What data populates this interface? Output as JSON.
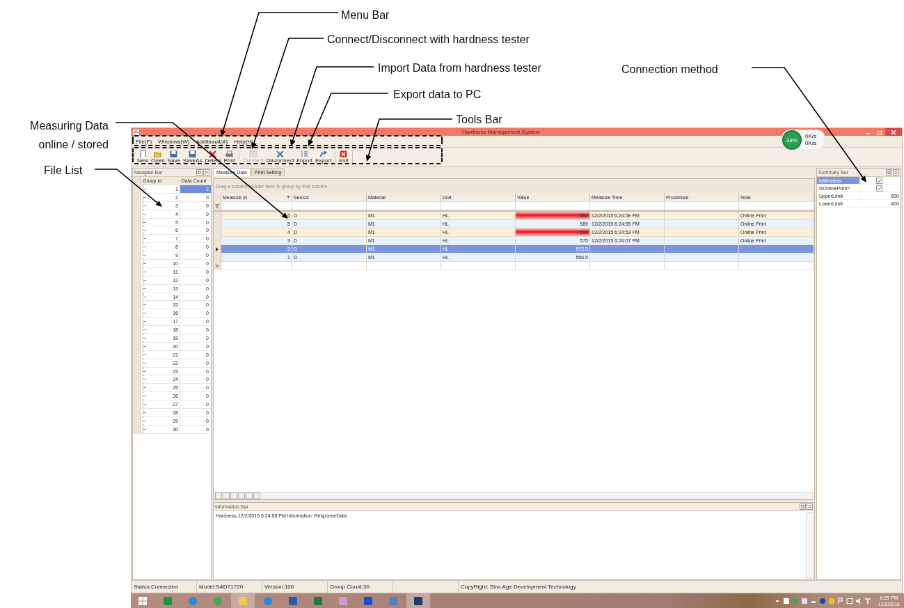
{
  "annotations": [
    {
      "lines": [
        "Menu Bar"
      ]
    },
    {
      "lines": [
        "Connect/Disconnect with hardness tester"
      ]
    },
    {
      "lines": [
        "Import Data from hardness tester"
      ]
    },
    {
      "lines": [
        "Export data to PC"
      ]
    },
    {
      "lines": [
        "Tools Bar"
      ]
    },
    {
      "lines": [
        "Connection method"
      ]
    },
    {
      "lines": [
        "Measuring Data",
        "online / stored"
      ]
    },
    {
      "lines": [
        "File List"
      ]
    }
  ],
  "window": {
    "title": "Hardness Management System"
  },
  "menu": [
    "File(F)",
    "Windows(W)",
    "Additional(A)",
    "Help(H)"
  ],
  "net_widget": {
    "percent": "38%",
    "up": "0K/s",
    "down": "0K/s"
  },
  "toolbar": [
    [
      {
        "label": "New",
        "kind": "new",
        "disabled": false
      },
      {
        "label": "Open",
        "kind": "open",
        "disabled": false
      },
      {
        "label": "Save",
        "kind": "save",
        "disabled": false
      },
      {
        "label": "SaveAs",
        "kind": "save",
        "disabled": false
      },
      {
        "label": "Delete",
        "kind": "delete",
        "disabled": false
      },
      {
        "label": "Print",
        "kind": "print",
        "disabled": false
      }
    ],
    [
      {
        "label": "Connect",
        "kind": "connect",
        "disabled": true
      },
      {
        "label": "Disconnect",
        "kind": "disconnect",
        "disabled": false
      },
      {
        "label": "Import",
        "kind": "import",
        "disabled": false
      },
      {
        "label": "Export",
        "kind": "export",
        "disabled": false
      }
    ],
    [
      {
        "label": "Exit",
        "kind": "exit",
        "disabled": false
      }
    ]
  ],
  "navigate_bar": {
    "title": "Navigate Bar",
    "columns": [
      "Group Id",
      "Data Count"
    ],
    "rows": [
      {
        "id": "1",
        "count": "2",
        "selected": true
      },
      {
        "id": "2",
        "count": "0",
        "selected": false
      },
      {
        "id": "3",
        "count": "0",
        "selected": false
      },
      {
        "id": "4",
        "count": "0",
        "selected": false
      },
      {
        "id": "5",
        "count": "0",
        "selected": false
      },
      {
        "id": "6",
        "count": "0",
        "selected": false
      },
      {
        "id": "7",
        "count": "0",
        "selected": false
      },
      {
        "id": "8",
        "count": "0",
        "selected": false
      },
      {
        "id": "9",
        "count": "0",
        "selected": false
      },
      {
        "id": "10",
        "count": "0",
        "selected": false
      },
      {
        "id": "11",
        "count": "0",
        "selected": false
      },
      {
        "id": "12",
        "count": "0",
        "selected": false
      },
      {
        "id": "13",
        "count": "0",
        "selected": false
      },
      {
        "id": "14",
        "count": "0",
        "selected": false
      },
      {
        "id": "15",
        "count": "0",
        "selected": false
      },
      {
        "id": "16",
        "count": "0",
        "selected": false
      },
      {
        "id": "17",
        "count": "0",
        "selected": false
      },
      {
        "id": "18",
        "count": "0",
        "selected": false
      },
      {
        "id": "19",
        "count": "0",
        "selected": false
      },
      {
        "id": "20",
        "count": "0",
        "selected": false
      },
      {
        "id": "21",
        "count": "0",
        "selected": false
      },
      {
        "id": "22",
        "count": "0",
        "selected": false
      },
      {
        "id": "23",
        "count": "0",
        "selected": false
      },
      {
        "id": "24",
        "count": "0",
        "selected": false
      },
      {
        "id": "25",
        "count": "0",
        "selected": false
      },
      {
        "id": "26",
        "count": "0",
        "selected": false
      },
      {
        "id": "27",
        "count": "0",
        "selected": false
      },
      {
        "id": "28",
        "count": "0",
        "selected": false
      },
      {
        "id": "29",
        "count": "0",
        "selected": false
      },
      {
        "id": "30",
        "count": "0",
        "selected": false
      }
    ]
  },
  "tabs": [
    {
      "label": "Measure Data",
      "selected": true
    },
    {
      "label": "Print Setting",
      "selected": false
    }
  ],
  "group_hint": "Drag a column header here to group by that column",
  "grid": {
    "columns": [
      "Measure Id",
      "Sensor",
      "Material",
      "Unit",
      "Value",
      "Measure Time",
      "Procedure",
      "Note"
    ],
    "rows": [
      {
        "cells": [
          "6",
          "D",
          "M1",
          "HL",
          "602",
          "12/2/2015 6:24:58 PM",
          "",
          "Online Print"
        ],
        "over_limit": true,
        "selected": false
      },
      {
        "cells": [
          "5",
          "D",
          "M1",
          "HL",
          "589",
          "12/2/2015 6:24:55 PM",
          "",
          "Online Print"
        ],
        "over_limit": false,
        "selected": false
      },
      {
        "cells": [
          "4",
          "D",
          "M1",
          "HL",
          "604",
          "12/2/2015 6:24:53 PM",
          "",
          "Online Print"
        ],
        "over_limit": true,
        "selected": false
      },
      {
        "cells": [
          "3",
          "D",
          "M1",
          "HL",
          "575",
          "12/2/2015 6:24:07 PM",
          "",
          "Online Print"
        ],
        "over_limit": false,
        "selected": false
      },
      {
        "cells": [
          "2",
          "D",
          "M1",
          "HL",
          "572.3",
          "",
          "",
          ""
        ],
        "over_limit": false,
        "selected": true
      },
      {
        "cells": [
          "1",
          "D",
          "M1",
          "HL",
          "566.5",
          "",
          "",
          ""
        ],
        "over_limit": false,
        "selected": false
      }
    ]
  },
  "info_bar": {
    "title": "Information Bar",
    "lines": [
      "Hardness,12/2/2015 6:24:58 PM Information: ResponseData:"
    ]
  },
  "summary_bar": {
    "title": "Summary Bar",
    "rows": [
      {
        "name": "IsWireless",
        "kind": "check",
        "checked": true,
        "selected": true
      },
      {
        "name": "IsOnlinePrint?",
        "kind": "check",
        "checked": true,
        "selected": false
      },
      {
        "name": "UpperLimit",
        "kind": "value",
        "value": "600",
        "selected": false
      },
      {
        "name": "LowerLimit",
        "kind": "value",
        "value": "400",
        "selected": false
      }
    ]
  },
  "status_bar": [
    "Status:Connected",
    "Model:SADT1720",
    "Version:100",
    "Group Count:30",
    "CopyRight: Sino Age Development Technology"
  ],
  "taskbar": {
    "apps": [
      {
        "kind": "start",
        "active": false
      },
      {
        "kind": "store",
        "active": false
      },
      {
        "kind": "browser",
        "active": false
      },
      {
        "kind": "circle",
        "active": false
      },
      {
        "kind": "folder",
        "active": true
      },
      {
        "kind": "cloud",
        "active": false
      },
      {
        "kind": "word",
        "active": false
      },
      {
        "kind": "excel",
        "active": false
      },
      {
        "kind": "paint",
        "active": false
      },
      {
        "kind": "monitor",
        "active": false
      },
      {
        "kind": "screen",
        "active": false
      },
      {
        "kind": "tester",
        "active": true
      }
    ],
    "time": "6:25 PM",
    "date": "12/2/2015"
  }
}
